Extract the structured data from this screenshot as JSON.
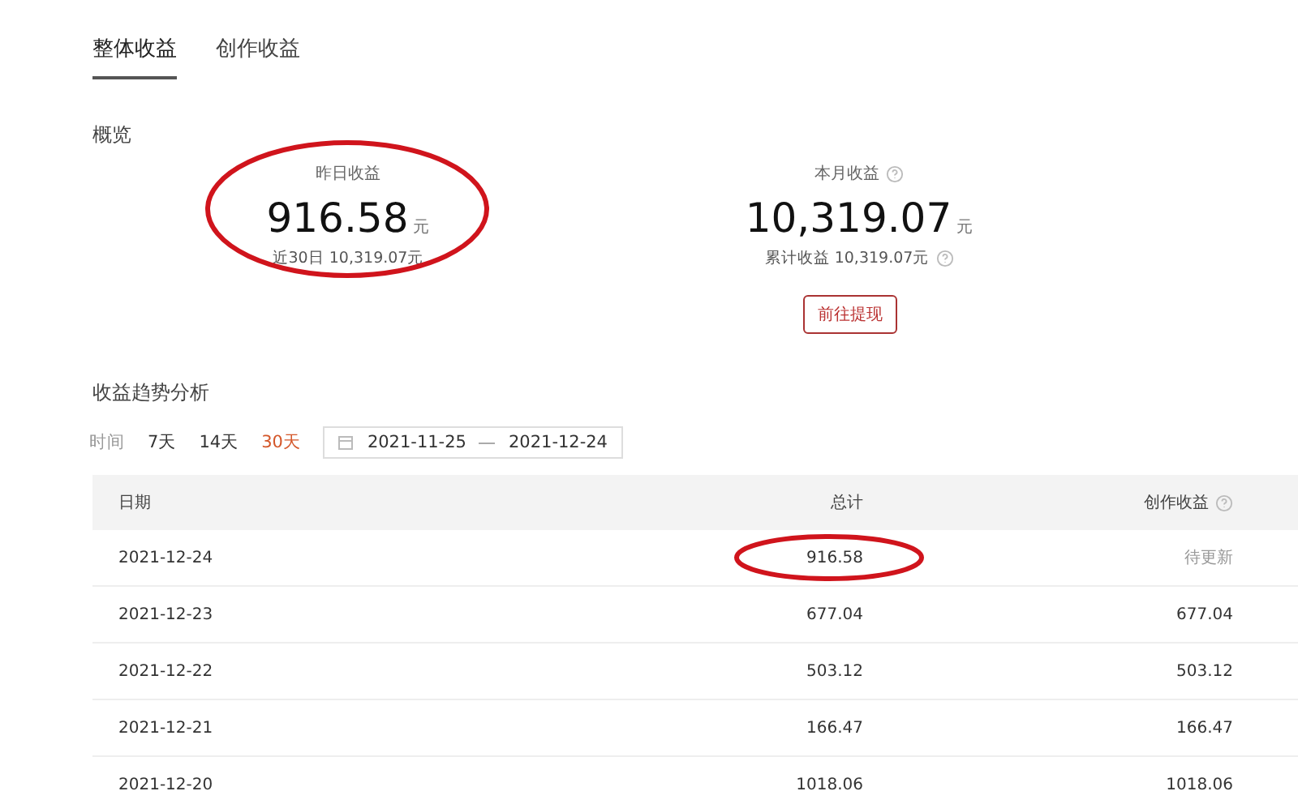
{
  "tabs": [
    {
      "label": "整体收益",
      "selected": true
    },
    {
      "label": "创作收益",
      "selected": false
    }
  ],
  "overview": {
    "title": "概览",
    "stats": [
      {
        "label": "昨日收益",
        "value": "916.58",
        "unit": "元",
        "sub": "近30日 10,319.07元",
        "highlighted": true
      },
      {
        "label": "本月收益",
        "info": true,
        "value": "10,319.07",
        "unit": "元",
        "sub": "累计收益 10,319.07元",
        "sub_info": true
      }
    ],
    "withdraw_button": "前往提现"
  },
  "trend": {
    "title": "收益趋势分析",
    "time_label": "时间",
    "periods": [
      {
        "label": "7天",
        "selected": false
      },
      {
        "label": "14天",
        "selected": false
      },
      {
        "label": "30天",
        "selected": true
      }
    ],
    "date_start": "2021-11-25",
    "date_end": "2021-12-24"
  },
  "table": {
    "columns": [
      {
        "label": "日期"
      },
      {
        "label": "总计"
      },
      {
        "label": "创作收益",
        "info": true
      }
    ],
    "rows": [
      {
        "date": "2021-12-24",
        "total": "916.58",
        "creation": "待更新",
        "pending": true,
        "highlighted": true
      },
      {
        "date": "2021-12-23",
        "total": "677.04",
        "creation": "677.04",
        "pending": false
      },
      {
        "date": "2021-12-22",
        "total": "503.12",
        "creation": "503.12",
        "pending": false
      },
      {
        "date": "2021-12-21",
        "total": "166.47",
        "creation": "166.47",
        "pending": false
      },
      {
        "date": "2021-12-20",
        "total": "1018.06",
        "creation": "1018.06",
        "pending": false
      }
    ]
  }
}
